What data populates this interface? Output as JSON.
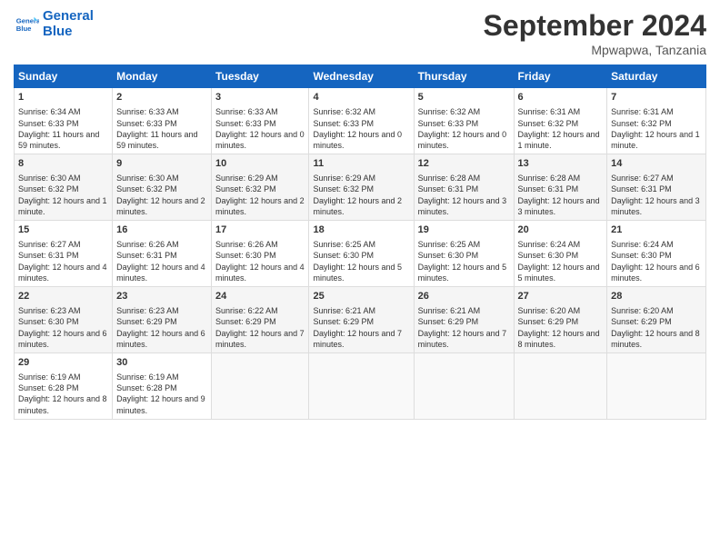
{
  "header": {
    "logo_line1": "General",
    "logo_line2": "Blue",
    "month": "September 2024",
    "location": "Mpwapwa, Tanzania"
  },
  "columns": [
    "Sunday",
    "Monday",
    "Tuesday",
    "Wednesday",
    "Thursday",
    "Friday",
    "Saturday"
  ],
  "weeks": [
    [
      {
        "day": "1",
        "info": "Sunrise: 6:34 AM\nSunset: 6:33 PM\nDaylight: 11 hours and 59 minutes."
      },
      {
        "day": "2",
        "info": "Sunrise: 6:33 AM\nSunset: 6:33 PM\nDaylight: 11 hours and 59 minutes."
      },
      {
        "day": "3",
        "info": "Sunrise: 6:33 AM\nSunset: 6:33 PM\nDaylight: 12 hours and 0 minutes."
      },
      {
        "day": "4",
        "info": "Sunrise: 6:32 AM\nSunset: 6:33 PM\nDaylight: 12 hours and 0 minutes."
      },
      {
        "day": "5",
        "info": "Sunrise: 6:32 AM\nSunset: 6:33 PM\nDaylight: 12 hours and 0 minutes."
      },
      {
        "day": "6",
        "info": "Sunrise: 6:31 AM\nSunset: 6:32 PM\nDaylight: 12 hours and 1 minute."
      },
      {
        "day": "7",
        "info": "Sunrise: 6:31 AM\nSunset: 6:32 PM\nDaylight: 12 hours and 1 minute."
      }
    ],
    [
      {
        "day": "8",
        "info": "Sunrise: 6:30 AM\nSunset: 6:32 PM\nDaylight: 12 hours and 1 minute."
      },
      {
        "day": "9",
        "info": "Sunrise: 6:30 AM\nSunset: 6:32 PM\nDaylight: 12 hours and 2 minutes."
      },
      {
        "day": "10",
        "info": "Sunrise: 6:29 AM\nSunset: 6:32 PM\nDaylight: 12 hours and 2 minutes."
      },
      {
        "day": "11",
        "info": "Sunrise: 6:29 AM\nSunset: 6:32 PM\nDaylight: 12 hours and 2 minutes."
      },
      {
        "day": "12",
        "info": "Sunrise: 6:28 AM\nSunset: 6:31 PM\nDaylight: 12 hours and 3 minutes."
      },
      {
        "day": "13",
        "info": "Sunrise: 6:28 AM\nSunset: 6:31 PM\nDaylight: 12 hours and 3 minutes."
      },
      {
        "day": "14",
        "info": "Sunrise: 6:27 AM\nSunset: 6:31 PM\nDaylight: 12 hours and 3 minutes."
      }
    ],
    [
      {
        "day": "15",
        "info": "Sunrise: 6:27 AM\nSunset: 6:31 PM\nDaylight: 12 hours and 4 minutes."
      },
      {
        "day": "16",
        "info": "Sunrise: 6:26 AM\nSunset: 6:31 PM\nDaylight: 12 hours and 4 minutes."
      },
      {
        "day": "17",
        "info": "Sunrise: 6:26 AM\nSunset: 6:30 PM\nDaylight: 12 hours and 4 minutes."
      },
      {
        "day": "18",
        "info": "Sunrise: 6:25 AM\nSunset: 6:30 PM\nDaylight: 12 hours and 5 minutes."
      },
      {
        "day": "19",
        "info": "Sunrise: 6:25 AM\nSunset: 6:30 PM\nDaylight: 12 hours and 5 minutes."
      },
      {
        "day": "20",
        "info": "Sunrise: 6:24 AM\nSunset: 6:30 PM\nDaylight: 12 hours and 5 minutes."
      },
      {
        "day": "21",
        "info": "Sunrise: 6:24 AM\nSunset: 6:30 PM\nDaylight: 12 hours and 6 minutes."
      }
    ],
    [
      {
        "day": "22",
        "info": "Sunrise: 6:23 AM\nSunset: 6:30 PM\nDaylight: 12 hours and 6 minutes."
      },
      {
        "day": "23",
        "info": "Sunrise: 6:23 AM\nSunset: 6:29 PM\nDaylight: 12 hours and 6 minutes."
      },
      {
        "day": "24",
        "info": "Sunrise: 6:22 AM\nSunset: 6:29 PM\nDaylight: 12 hours and 7 minutes."
      },
      {
        "day": "25",
        "info": "Sunrise: 6:21 AM\nSunset: 6:29 PM\nDaylight: 12 hours and 7 minutes."
      },
      {
        "day": "26",
        "info": "Sunrise: 6:21 AM\nSunset: 6:29 PM\nDaylight: 12 hours and 7 minutes."
      },
      {
        "day": "27",
        "info": "Sunrise: 6:20 AM\nSunset: 6:29 PM\nDaylight: 12 hours and 8 minutes."
      },
      {
        "day": "28",
        "info": "Sunrise: 6:20 AM\nSunset: 6:29 PM\nDaylight: 12 hours and 8 minutes."
      }
    ],
    [
      {
        "day": "29",
        "info": "Sunrise: 6:19 AM\nSunset: 6:28 PM\nDaylight: 12 hours and 8 minutes."
      },
      {
        "day": "30",
        "info": "Sunrise: 6:19 AM\nSunset: 6:28 PM\nDaylight: 12 hours and 9 minutes."
      },
      {
        "day": "",
        "info": ""
      },
      {
        "day": "",
        "info": ""
      },
      {
        "day": "",
        "info": ""
      },
      {
        "day": "",
        "info": ""
      },
      {
        "day": "",
        "info": ""
      }
    ]
  ]
}
